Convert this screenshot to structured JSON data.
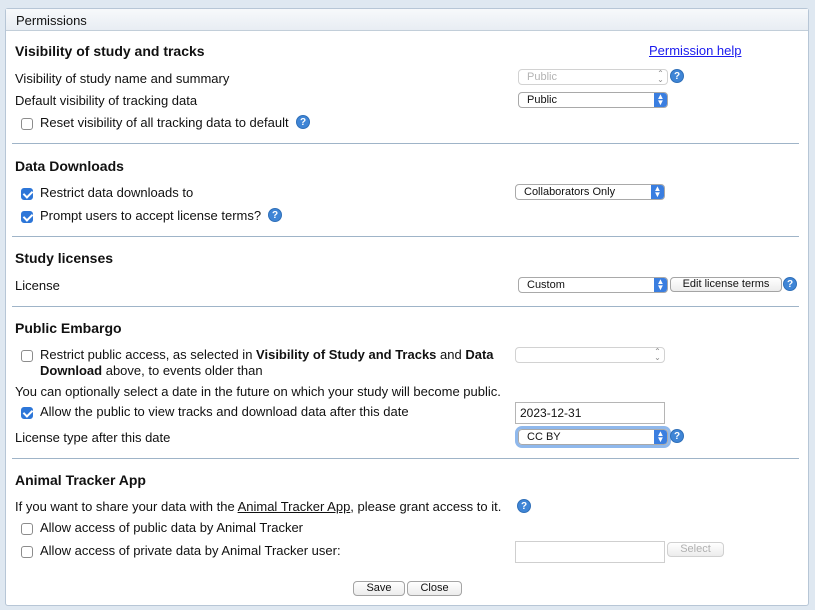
{
  "window": {
    "title": "Permissions"
  },
  "visibility": {
    "heading": "Visibility of study and tracks",
    "help_link": "Permission help",
    "study_label": "Visibility of study name and summary",
    "study_value": "Public",
    "tracking_label": "Default visibility of tracking data",
    "tracking_value": "Public",
    "reset_label": "Reset visibility of all tracking data to default",
    "reset_checked": false
  },
  "downloads": {
    "heading": "Data Downloads",
    "restrict_label": "Restrict data downloads to",
    "restrict_checked": true,
    "restrict_value": "Collaborators Only",
    "prompt_label": "Prompt users to accept license terms?",
    "prompt_checked": true
  },
  "licenses": {
    "heading": "Study licenses",
    "license_label": "License",
    "license_value": "Custom",
    "edit_button": "Edit license terms"
  },
  "embargo": {
    "heading": "Public Embargo",
    "restrict_pre": "Restrict public access, as selected in ",
    "restrict_b1": "Visibility of Study and Tracks",
    "restrict_mid": " and ",
    "restrict_b2a": "Data",
    "restrict_b2b": "Download",
    "restrict_post": " above, to events older than",
    "restrict_checked": false,
    "restrict_value": "",
    "optional_note": "You can optionally select a date in the future on which your study will become public.",
    "allow_label": "Allow the public to view tracks and download data after this date",
    "allow_checked": true,
    "date_value": "2023-12-31",
    "license_type_label": "License type after this date",
    "license_type_value": "CC BY"
  },
  "tracker": {
    "heading": "Animal Tracker App",
    "share_pre": "If you want to share your data with the ",
    "share_link": "Animal Tracker App",
    "share_post": ", please grant access to it.",
    "public_label": "Allow access of public data by Animal Tracker",
    "public_checked": false,
    "private_label": "Allow access of private data by Animal Tracker user:",
    "private_checked": false,
    "user_value": "",
    "select_button": "Select"
  },
  "footer": {
    "save": "Save",
    "close": "Close"
  },
  "colors": {
    "accent": "#3a7ee0",
    "rule": "#9fb4c8",
    "link": "#1a1aee"
  }
}
